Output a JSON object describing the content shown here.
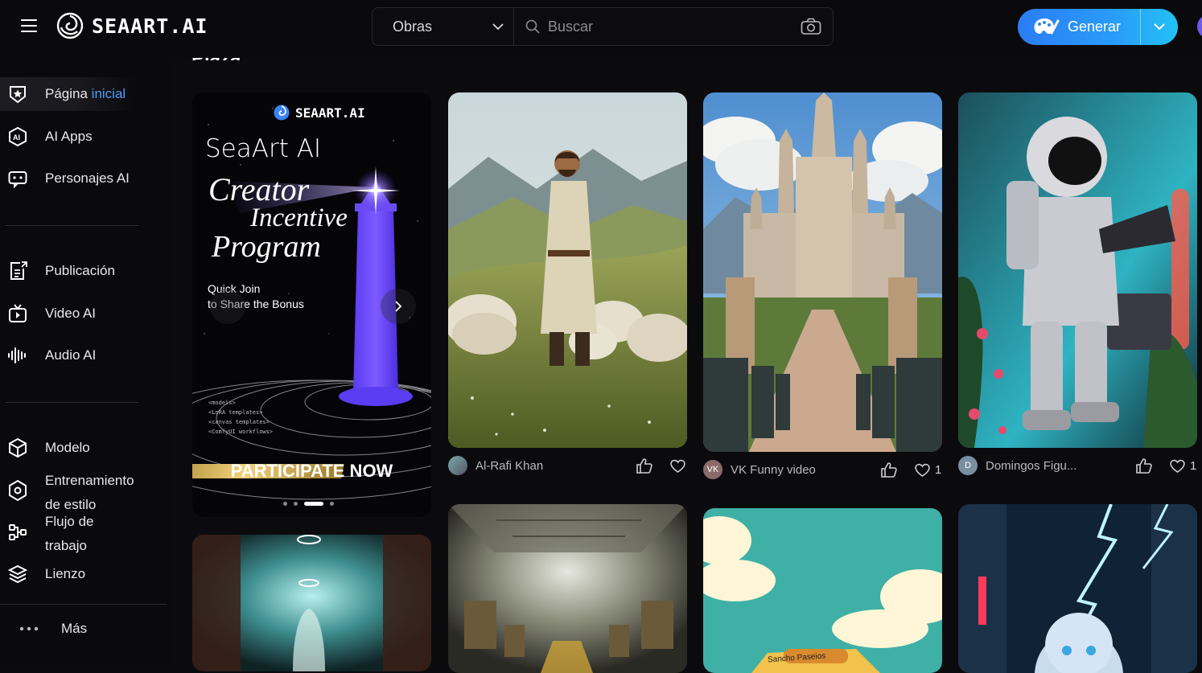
{
  "header": {
    "logo_text": "SEAART.AI",
    "search_category": "Obras",
    "search_placeholder": "Buscar",
    "generate_label": "Generar"
  },
  "sidebar": {
    "items": [
      {
        "label_prefix": "Página",
        "label_suffix": "inicial",
        "icon": "home-star-icon"
      },
      {
        "label": "AI Apps",
        "icon": "ai-apps-icon"
      },
      {
        "label": "Personajes AI",
        "icon": "characters-icon"
      },
      {
        "label": "Publicación",
        "icon": "publish-icon"
      },
      {
        "label": "Video AI",
        "icon": "video-icon"
      },
      {
        "label": "Audio AI",
        "icon": "audio-icon"
      },
      {
        "label": "Modelo",
        "icon": "model-cube-icon"
      },
      {
        "label_line1": "Entrenamiento",
        "label_line2": "de estilo",
        "icon": "training-icon"
      },
      {
        "label_line1": "Flujo de",
        "label_line2": "trabajo",
        "icon": "workflow-icon"
      },
      {
        "label": "Lienzo",
        "icon": "canvas-layers-icon"
      },
      {
        "label": "Más",
        "icon": "more-dots-icon"
      }
    ]
  },
  "main": {
    "section_title": "Plaza",
    "banner": {
      "logo_text": "SEAART.AI",
      "line1": "SeaArt AI",
      "line2": "Creator",
      "line3": "Incentive",
      "line4": "Program",
      "sub1": "Quick Join",
      "sub2": "to Share the Bonus",
      "code_lines": [
        "<models>",
        "<LoRA templates>",
        "<canvas templates>",
        "<ComfyUI workflows>"
      ],
      "cta": "PARTICIPATE NOW"
    },
    "cards": [
      {
        "author": "Al-Rafi Khan",
        "likes": "",
        "avatar_letter": ""
      },
      {
        "author": "VK Funny video",
        "likes": "1",
        "avatar_letter": "VK"
      },
      {
        "author": "Domingos Figu...",
        "likes": "1",
        "avatar_letter": "D"
      }
    ],
    "bottom_card_text": "Sancho Paseios"
  }
}
